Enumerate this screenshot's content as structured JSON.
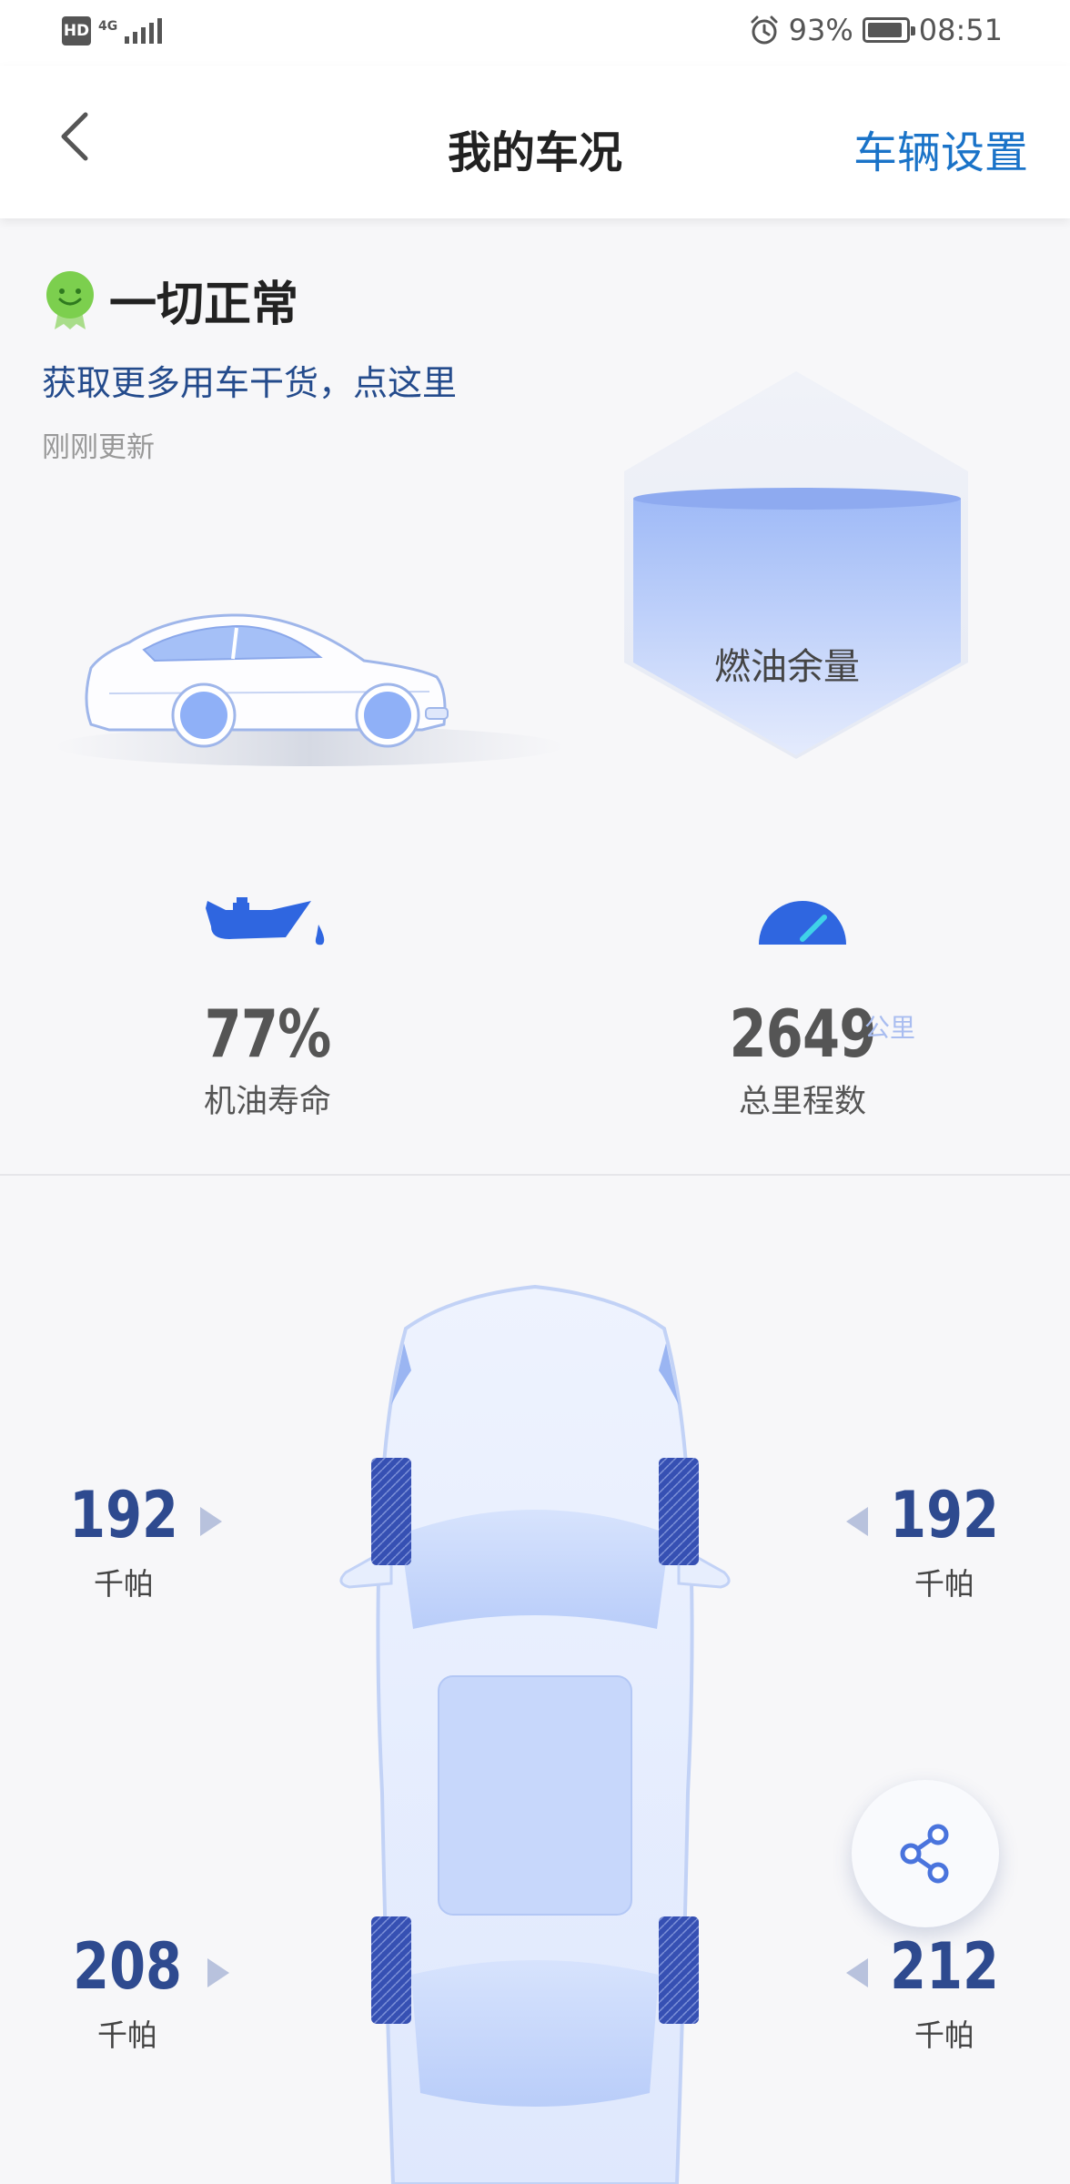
{
  "status_bar": {
    "hd_badge": "HD",
    "network": "4G",
    "battery_percent": "93%",
    "time": "08:51",
    "battery_level": 0.93
  },
  "nav": {
    "title": "我的车况",
    "action_label": "车辆设置"
  },
  "overview": {
    "status_title": "一切正常",
    "tip_link": "获取更多用车干货，点这里",
    "updated": "刚刚更新",
    "fuel_label": "燃油余量"
  },
  "metrics": {
    "oil_life": {
      "value": "77%",
      "label": "机油寿命"
    },
    "odometer": {
      "value": "2649",
      "unit": "公里",
      "label": "总里程数"
    }
  },
  "tires": {
    "front_left": {
      "value": "192",
      "unit": "千帕"
    },
    "front_right": {
      "value": "192",
      "unit": "千帕"
    },
    "rear_left": {
      "value": "208",
      "unit": "千帕"
    },
    "rear_right": {
      "value": "212",
      "unit": "千帕"
    }
  },
  "colors": {
    "accent": "#1a73c8",
    "tire_value": "#2e4a8f",
    "car_blue": "#8fb0f7",
    "status_green": "#7ccf4e"
  },
  "icons": {
    "back": "chevron-left-icon",
    "status": "smiley-badge-icon",
    "oil": "oil-can-icon",
    "odometer": "speedometer-icon",
    "share": "share-icon"
  }
}
